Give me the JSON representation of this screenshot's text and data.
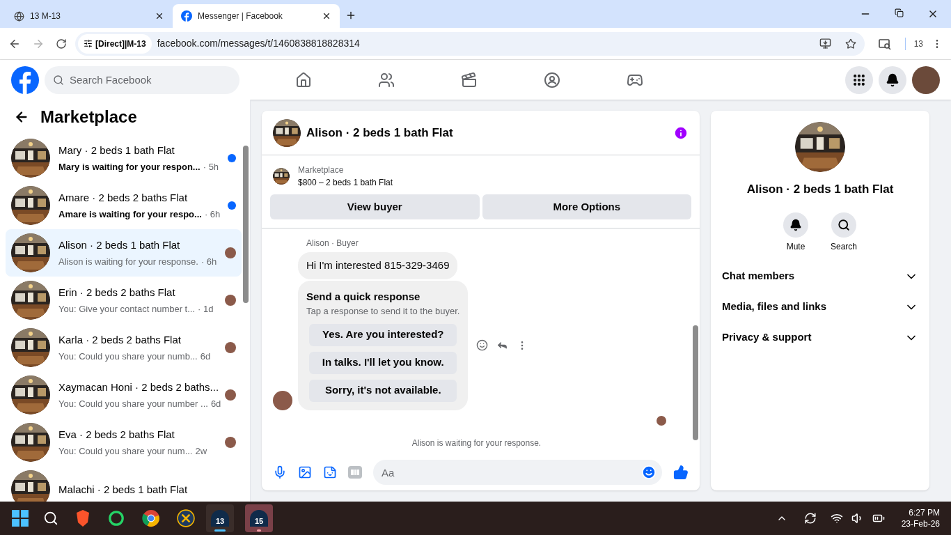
{
  "browser": {
    "tabs": [
      {
        "title": "13 M-13",
        "selected": false
      },
      {
        "title": "Messenger | Facebook",
        "selected": true
      }
    ],
    "site_chip": "[Direct]|M-13",
    "url": "facebook.com/messages/t/1460838818828314",
    "profile_count": "13"
  },
  "header": {
    "search_placeholder": "Search Facebook"
  },
  "sidebar": {
    "title": "Marketplace",
    "conversations": [
      {
        "name": "Mary · 2 beds 1 bath Flat",
        "preview": "Mary is waiting for your respon...",
        "time": "· 5h",
        "unread": true,
        "selected": false
      },
      {
        "name": "Amare · 2 beds 2 baths Flat",
        "preview": "Amare is waiting for your respo...",
        "time": "· 6h",
        "unread": true,
        "selected": false
      },
      {
        "name": "Alison · 2 beds 1 bath Flat",
        "preview": "Alison is waiting for your response.",
        "time": "· 6h",
        "unread": false,
        "selected": true
      },
      {
        "name": "Erin · 2 beds 2 baths Flat",
        "preview": "You: Give your contact number t...",
        "time": "· 1d",
        "unread": false,
        "selected": false
      },
      {
        "name": "Karla · 2 beds 2 baths Flat",
        "preview": "You: Could you share your numb...",
        "time": "6d",
        "unread": false,
        "selected": false
      },
      {
        "name": "Xaymacan Honi · 2 beds 2 baths...",
        "preview": "You: Could you share your number ...",
        "time": "6d",
        "unread": false,
        "selected": false
      },
      {
        "name": "Eva · 2 beds 2 baths Flat",
        "preview": "You: Could you share your num...",
        "time": "2w",
        "unread": false,
        "selected": false
      },
      {
        "name": "Malachi · 2 beds 1 bath Flat",
        "selected": false
      }
    ]
  },
  "chat": {
    "title": "Alison · 2 beds 1 bath Flat",
    "listing": {
      "label": "Marketplace",
      "price": "$800 – 2 beds 1 bath Flat"
    },
    "buttons": [
      "View buyer",
      "More Options"
    ],
    "sender": "Alison · Buyer",
    "message": "Hi I'm interested 815-329-3469",
    "quick": {
      "title": "Send a quick response",
      "subtitle": "Tap a response to send it to the buyer.",
      "options": [
        "Yes. Are you interested?",
        "In talks. I'll let you know.",
        "Sorry, it's not available."
      ]
    },
    "status": "Alison is waiting for your response.",
    "composer_placeholder": "Aa"
  },
  "details": {
    "name": "Alison · 2 beds 1 bath Flat",
    "actions": [
      "Mute",
      "Search"
    ],
    "sections": [
      {
        "label": "Chat members",
        "expanded": false
      },
      {
        "label": "Media, files and links",
        "expanded": false
      },
      {
        "label": "Privacy & support",
        "expanded": false
      }
    ]
  },
  "taskbar": {
    "apps": [
      {
        "label": "13",
        "active": true
      },
      {
        "label": "15",
        "active": false
      }
    ],
    "time": "6:27 PM",
    "date": "23-Feb-26"
  }
}
